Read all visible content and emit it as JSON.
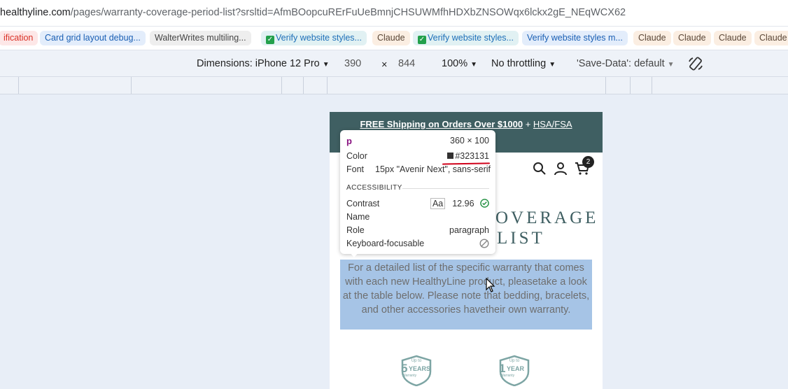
{
  "address_bar": {
    "host": "healthyline.com",
    "path": "/pages/warranty-coverage-period-list?srsltid=AfmBOopcuRErFuUeBmnjCHSUWMfhHDXbZNSOWqx6lckx2gE_NEqWCX62"
  },
  "bookmarks": [
    {
      "label": "ification",
      "color": "#d93025",
      "bg": "#fde7e7",
      "check": false
    },
    {
      "label": "Card grid layout debug...",
      "color": "#1a5fb4",
      "bg": "#e3edfb",
      "check": false
    },
    {
      "label": "WalterWrites multiling...",
      "color": "#444",
      "bg": "#eeeeee",
      "check": false
    },
    {
      "label": "Verify website styles...",
      "color": "#1d6fb8",
      "bg": "#e1f1f3",
      "check": true
    },
    {
      "label": "Claude",
      "color": "#5a4636",
      "bg": "#fbeee2",
      "check": false
    },
    {
      "label": "Verify website styles...",
      "color": "#1d6fb8",
      "bg": "#e1f1f3",
      "check": true
    },
    {
      "label": "Verify website styles m...",
      "color": "#1a5fb4",
      "bg": "#e3edfb",
      "check": false
    },
    {
      "label": "Claude",
      "color": "#5a4636",
      "bg": "#fbeee2",
      "check": false
    },
    {
      "label": "Claude",
      "color": "#5a4636",
      "bg": "#fbeee2",
      "check": false
    },
    {
      "label": "Claude",
      "color": "#5a4636",
      "bg": "#fbeee2",
      "check": false
    },
    {
      "label": "Claude",
      "color": "#5a4636",
      "bg": "#fbeee2",
      "check": false
    }
  ],
  "device_toolbar": {
    "dimensions_label": "Dimensions: iPhone 12 Pro",
    "width": "390",
    "times": "×",
    "height": "844",
    "zoom": "100%",
    "throttling": "No throttling",
    "save_data": "'Save-Data': default"
  },
  "page": {
    "shipping_text_bold": "FREE Shipping on Orders Over $1000",
    "shipping_plus": " + ",
    "shipping_link": "HSA/FSA",
    "cart_count": "2",
    "logo_fragment": "e",
    "title_line1_fragment": "OVERAGE",
    "title_line2_fragment": "LIST",
    "paragraph": "For a detailed list of the specific warranty that comes with each new HealthyLine product, pleasetake a look at the table below. Please note that bedding, bracelets, and other accessories havetheir own warranty.",
    "badges": [
      {
        "num": "5",
        "unit": "YEARS",
        "top": "Up to",
        "bottom": "Warranty"
      },
      {
        "num": "1",
        "unit": "YEAR",
        "top": "Up to",
        "bottom": "Warranty"
      }
    ]
  },
  "inspector_tooltip": {
    "tag": "p",
    "size": "360 × 100",
    "color_label": "Color",
    "color_value": "#323131",
    "font_label": "Font",
    "font_value": "15px \"Avenir Next\", sans-serif",
    "section": "ACCESSIBILITY",
    "contrast_label": "Contrast",
    "contrast_aa": "Aa",
    "contrast_value": "12.96",
    "name_label": "Name",
    "role_label": "Role",
    "role_value": "paragraph",
    "keyboard_label": "Keyboard-focusable"
  },
  "colors": {
    "accent_teal": "#3f5f62",
    "selection": "#a6c4e6",
    "tag_purple": "#881280",
    "underline_red": "#d0021b"
  }
}
